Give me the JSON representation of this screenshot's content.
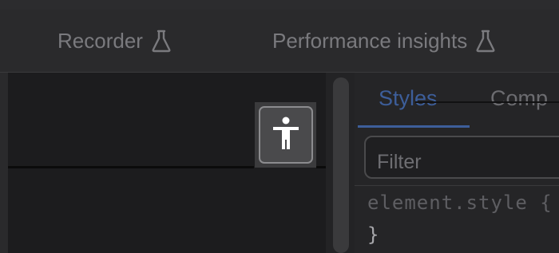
{
  "tabs": [
    {
      "label": "Recorder",
      "icon": "flask-icon",
      "experimental": true
    },
    {
      "label": "Performance insights",
      "icon": "flask-icon",
      "experimental": true
    }
  ],
  "accessibility_button": {
    "icon": "accessibility-person-icon"
  },
  "styles_panel": {
    "tabs": [
      {
        "label": "Styles",
        "active": true
      },
      {
        "label": "Comp",
        "active": false
      }
    ],
    "filter": {
      "placeholder": "Filter",
      "value": ""
    },
    "element_style": {
      "selector": "element.style {",
      "close": "}"
    }
  },
  "colors": {
    "background": "#232325",
    "active_tab": "#3d5e9a",
    "inactive_text": "#7a7a7e"
  }
}
